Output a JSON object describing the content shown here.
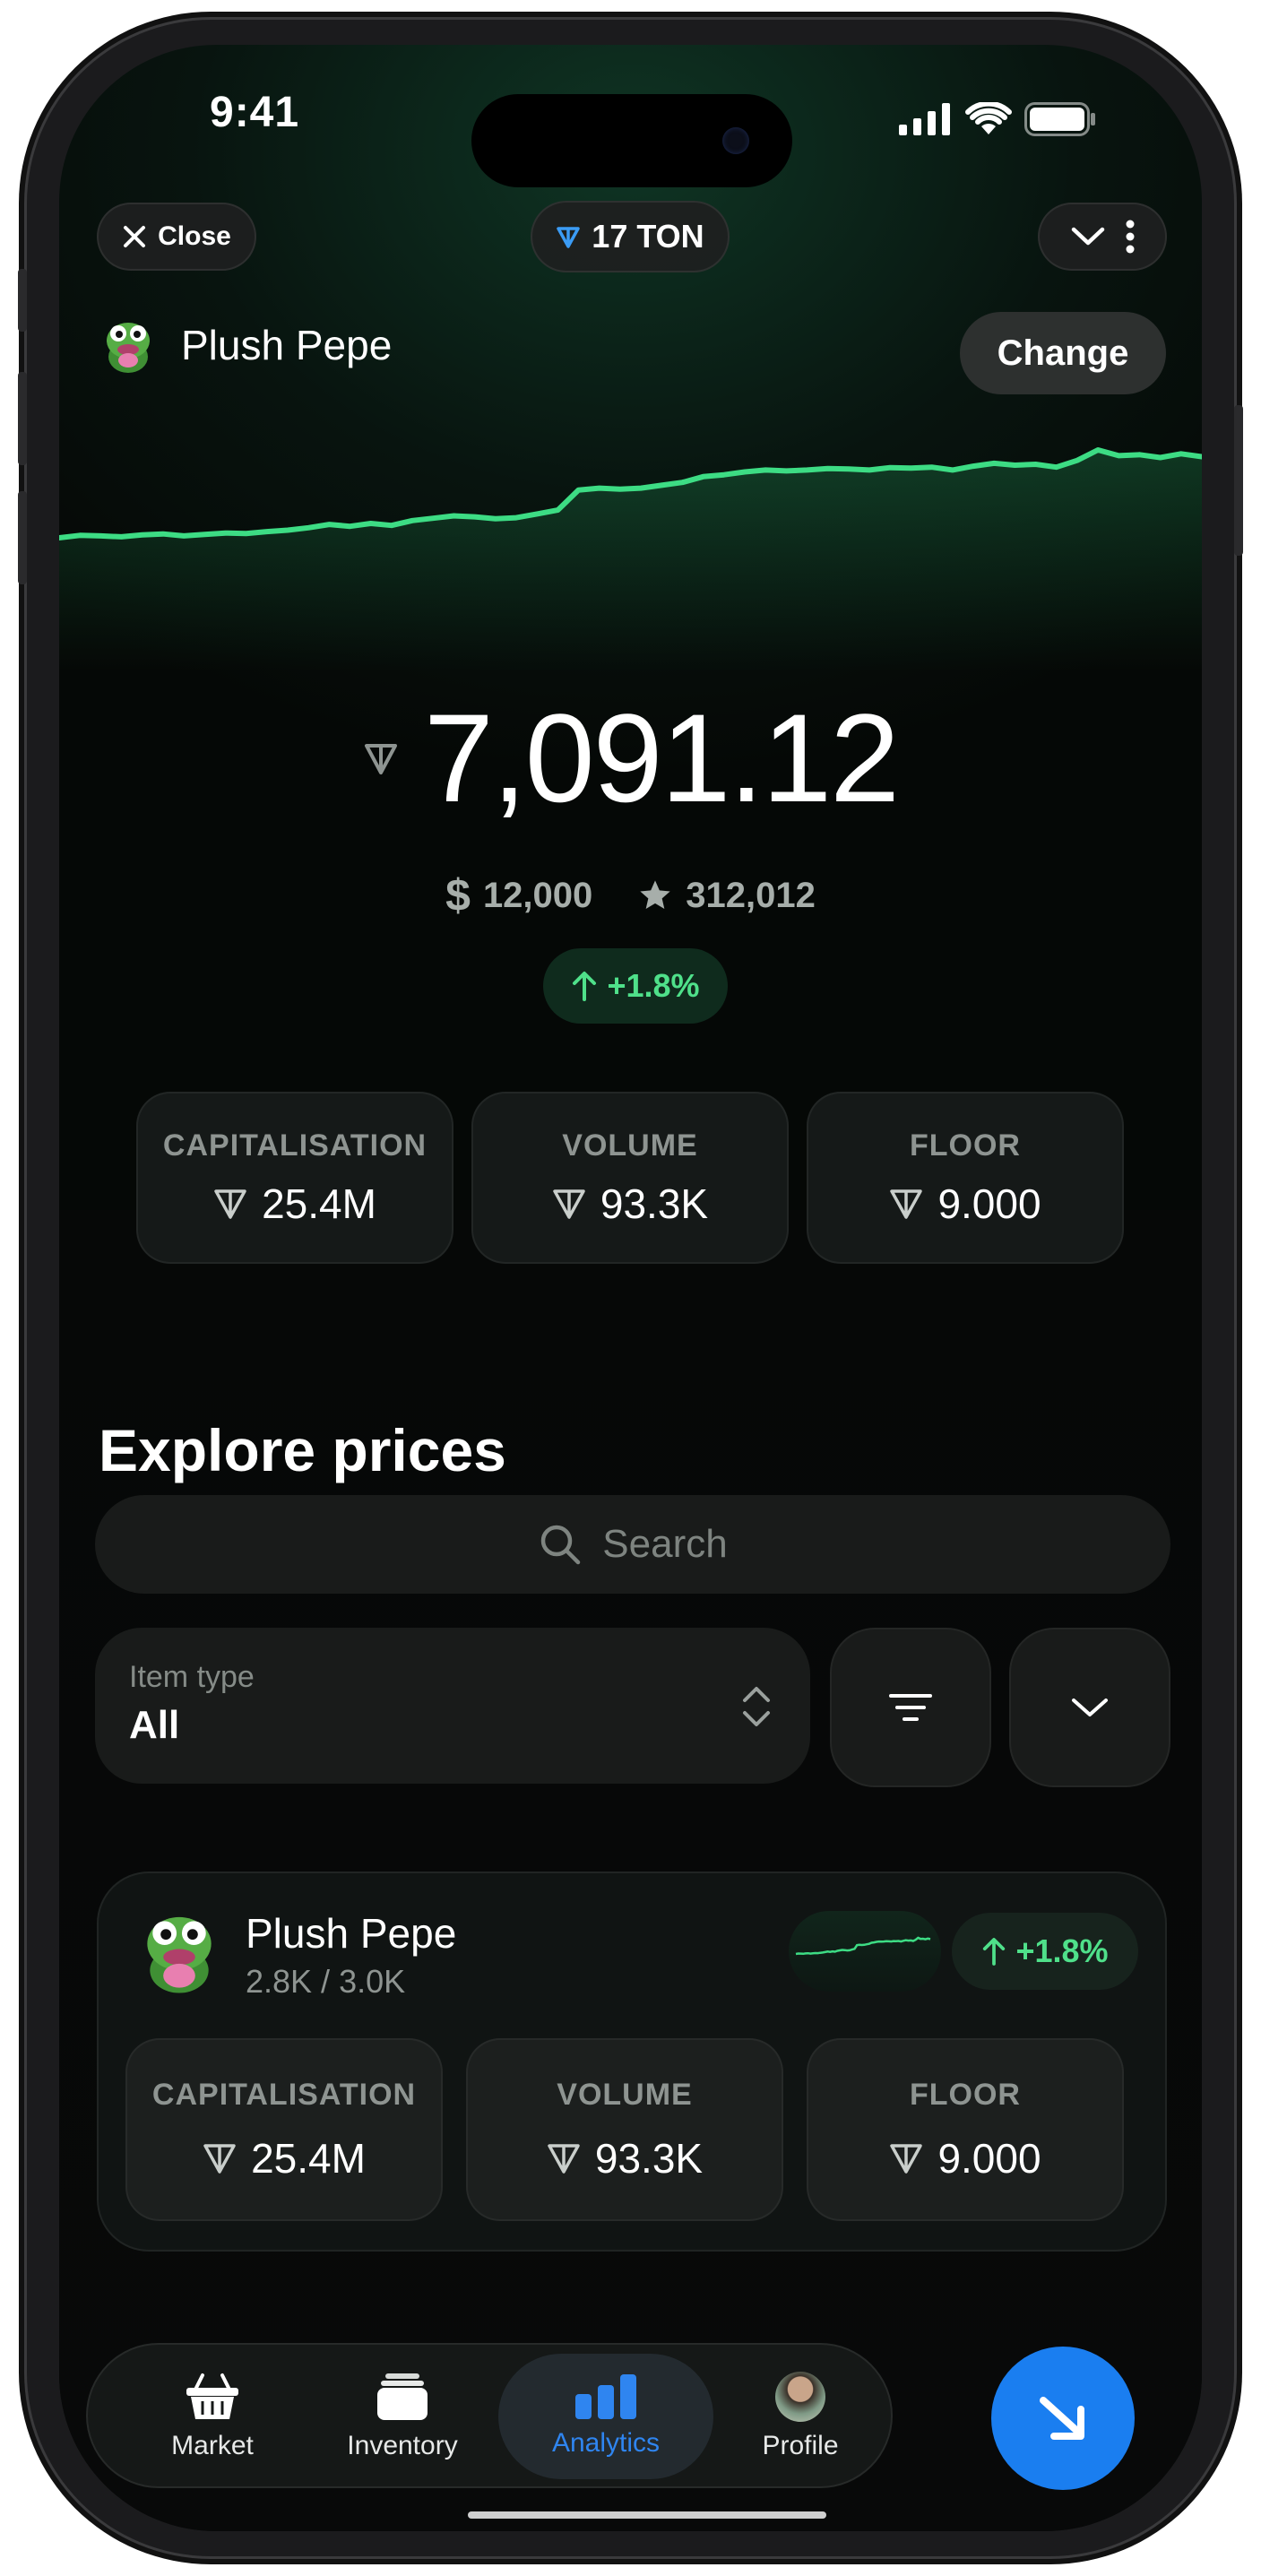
{
  "status_bar": {
    "time": "9:41"
  },
  "header": {
    "close_label": "Close",
    "balance": "17 TON"
  },
  "collection": {
    "name": "Plush Pepe",
    "change_label": "Change"
  },
  "price": {
    "value": "7,091.12",
    "usd": "12,000",
    "stars": "312,012",
    "change": "+1.8%"
  },
  "stats": [
    {
      "label": "CAPITALISATION",
      "value": "25.4M"
    },
    {
      "label": "VOLUME",
      "value": "93.3K"
    },
    {
      "label": "FLOOR",
      "value": "9.000"
    }
  ],
  "explore": {
    "title": "Explore prices",
    "search_placeholder": "Search",
    "item_type_label": "Item type",
    "item_type_value": "All"
  },
  "item_card": {
    "name": "Plush Pepe",
    "supply": "2.8K / 3.0K",
    "change": "+1.8%",
    "stats": [
      {
        "label": "CAPITALISATION",
        "value": "25.4M"
      },
      {
        "label": "VOLUME",
        "value": "93.3K"
      },
      {
        "label": "FLOOR",
        "value": "9.000"
      }
    ]
  },
  "tabbar": {
    "tabs": [
      {
        "label": "Market",
        "icon": "basket-icon"
      },
      {
        "label": "Inventory",
        "icon": "inventory-icon"
      },
      {
        "label": "Analytics",
        "icon": "bar-chart-icon"
      },
      {
        "label": "Profile",
        "icon": "avatar"
      }
    ],
    "active": "Analytics"
  },
  "chart_data": {
    "type": "area",
    "x": [
      0,
      1,
      2,
      3,
      4,
      5,
      6,
      7,
      8,
      9,
      10,
      11,
      12,
      13,
      14,
      15,
      16,
      17,
      18,
      19,
      20,
      21,
      22,
      23,
      24,
      25,
      26,
      27,
      28,
      29,
      30,
      31,
      32,
      33,
      34,
      35,
      36,
      37,
      38,
      39,
      40,
      41,
      42,
      43,
      44,
      45,
      46,
      47,
      48,
      49,
      50,
      51,
      52,
      53,
      54,
      55
    ],
    "values": [
      6150,
      6175,
      6170,
      6160,
      6180,
      6190,
      6170,
      6185,
      6200,
      6195,
      6215,
      6230,
      6255,
      6290,
      6270,
      6300,
      6280,
      6330,
      6355,
      6380,
      6370,
      6350,
      6360,
      6400,
      6440,
      6650,
      6670,
      6660,
      6670,
      6700,
      6730,
      6790,
      6810,
      6840,
      6860,
      6850,
      6860,
      6875,
      6870,
      6860,
      6885,
      6880,
      6890,
      6860,
      6900,
      6930,
      6910,
      6920,
      6890,
      6960,
      7070,
      7010,
      7020,
      6990,
      7030,
      7000
    ],
    "color": "#3ddc84"
  },
  "colors": {
    "accent_green": "#4fe08a",
    "accent_blue": "#1a7ef0"
  }
}
